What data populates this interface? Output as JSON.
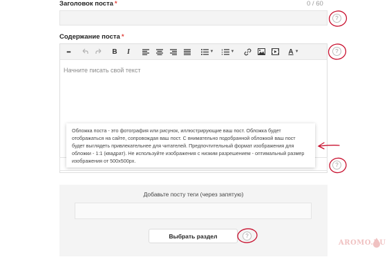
{
  "title_field": {
    "label": "Заголовок поста",
    "required_mark": "*",
    "counter": "0 / 60",
    "value": ""
  },
  "content_field": {
    "label": "Содержание поста",
    "required_mark": "*",
    "placeholder": "Начните писать свой текст"
  },
  "toolbar": {
    "more": "•••",
    "bold": "B",
    "italic": "I",
    "text_color": "A"
  },
  "tooltip": {
    "text": "Обложка поста - это фотография или рисунок, иллюстрирующие ваш пост. Обложка будет отображаться на сайте, сопровождая ваш пост. С внимательно подобранной обложкой ваш пост будет выглядеть привлекательнее для читателей. Предпочтительный формат изображения для обложки - 1:1 (квадрат). Не используйте изображения с низким разрешением - оптимальный размер изображения от 500x500px."
  },
  "tags": {
    "label": "Добавьте посту теги (через запятую)",
    "value": ""
  },
  "section_button": {
    "label": "Выбрать раздел"
  },
  "help": {
    "glyph": "?"
  },
  "watermark": {
    "text": "AROMO.RU"
  },
  "colors": {
    "required": "#e0403a",
    "annotation": "#c8102e",
    "panel": "#f4f4f4"
  }
}
